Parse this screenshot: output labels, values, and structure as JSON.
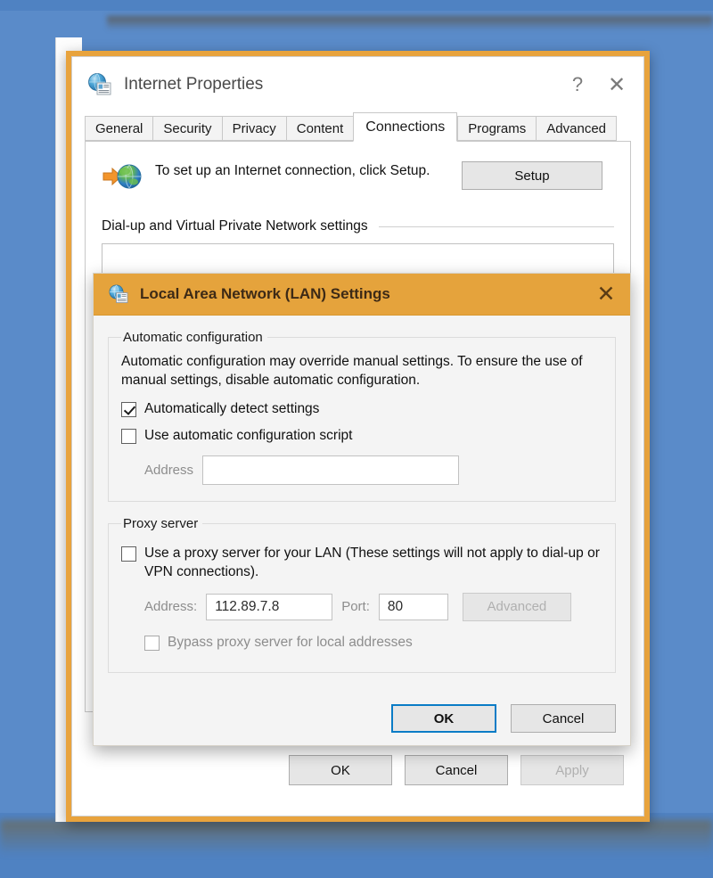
{
  "desktop": {
    "background_color": "#4f82c2"
  },
  "internet_properties": {
    "title": "Internet Properties",
    "icon": "internet-properties-icon",
    "help_label": "?",
    "close_label": "✕",
    "tabs": [
      {
        "label": "General",
        "active": false
      },
      {
        "label": "Security",
        "active": false
      },
      {
        "label": "Privacy",
        "active": false
      },
      {
        "label": "Content",
        "active": false
      },
      {
        "label": "Connections",
        "active": true
      },
      {
        "label": "Programs",
        "active": false
      },
      {
        "label": "Advanced",
        "active": false
      }
    ],
    "connections": {
      "setup_icon": "globe-with-arrow-icon",
      "setup_text": "To set up an Internet connection, click Setup.",
      "setup_button": "Setup",
      "dialup_section_label": "Dial-up and Virtual Private Network settings"
    },
    "buttons": {
      "ok": "OK",
      "cancel": "Cancel",
      "apply": "Apply",
      "apply_disabled": true
    }
  },
  "lan_settings": {
    "title": "Local Area Network (LAN) Settings",
    "icon": "internet-properties-icon",
    "close_label": "✕",
    "titlebar_color": "#e5a33c",
    "automatic_configuration": {
      "legend": "Automatic configuration",
      "description": "Automatic configuration may override manual settings.  To ensure the use of manual settings, disable automatic configuration.",
      "auto_detect": {
        "label": "Automatically detect settings",
        "checked": true,
        "enabled": true
      },
      "use_script": {
        "label": "Use automatic configuration script",
        "checked": false,
        "enabled": true
      },
      "address": {
        "label": "Address",
        "value": "",
        "placeholder": "",
        "enabled": false
      }
    },
    "proxy_server": {
      "legend": "Proxy server",
      "use_proxy": {
        "label": "Use a proxy server for your LAN (These settings will not apply to dial-up or VPN connections).",
        "checked": false,
        "enabled": true
      },
      "address": {
        "label": "Address:",
        "value": "112.89.7.8"
      },
      "port": {
        "label": "Port:",
        "value": "80"
      },
      "advanced_button": {
        "label": "Advanced",
        "enabled": false
      },
      "bypass_local": {
        "label": "Bypass proxy server for local addresses",
        "checked": false,
        "enabled": false
      }
    },
    "buttons": {
      "ok": "OK",
      "cancel": "Cancel",
      "ok_focused": true
    }
  }
}
